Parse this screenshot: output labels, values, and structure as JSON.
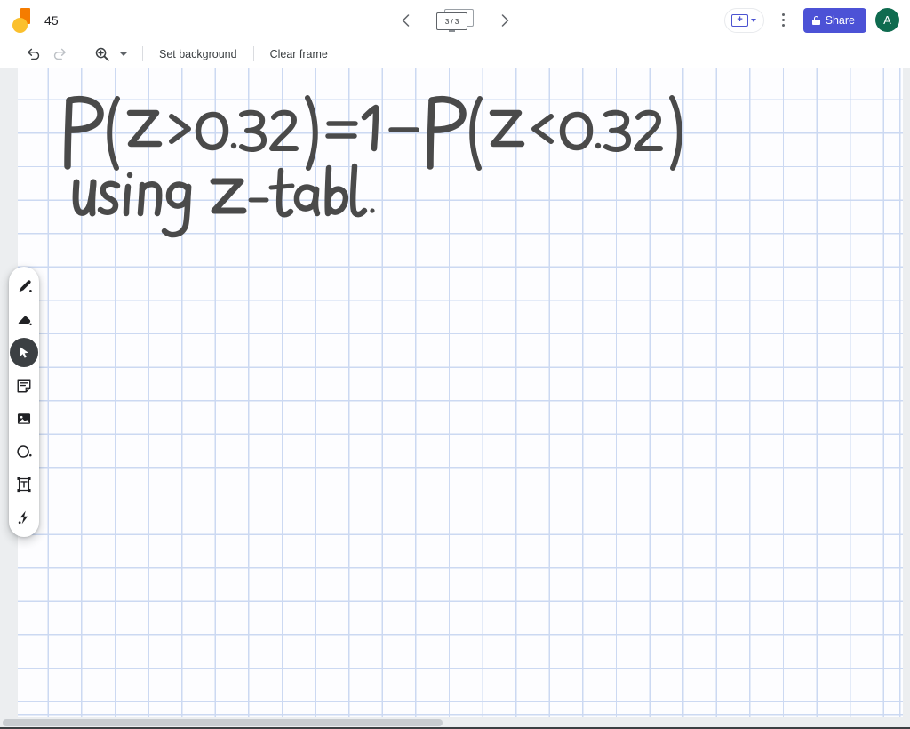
{
  "app": {
    "name": "Jamboard",
    "logo_icon": "jamboard-logo"
  },
  "header": {
    "doc_title": "45",
    "prev_frame_icon": "chevron-left-icon",
    "next_frame_icon": "chevron-right-icon",
    "frame_counter": "3 / 3",
    "frame_counter_icon": "frames-stack-icon",
    "present_icon": "present-add-frame-icon",
    "present_caret_icon": "chevron-down-icon",
    "more_options_icon": "kebab-menu-icon",
    "share_label": "Share",
    "share_lock_icon": "lock-icon",
    "avatar_initial": "A",
    "colors": {
      "share_bg": "#4c52d6",
      "avatar_bg": "#0f6b4f",
      "present_accent": "#4b53d1"
    }
  },
  "toolbar": {
    "undo_icon": "undo-icon",
    "redo_icon": "redo-icon",
    "zoom_icon": "zoom-in-icon",
    "zoom_caret_icon": "chevron-down-icon",
    "set_background_label": "Set background",
    "clear_frame_label": "Clear frame"
  },
  "tools": [
    {
      "name": "pen",
      "icon": "pen-icon",
      "active": false
    },
    {
      "name": "eraser",
      "icon": "eraser-icon",
      "active": false
    },
    {
      "name": "select",
      "icon": "cursor-arrow-icon",
      "active": true
    },
    {
      "name": "sticky-note",
      "icon": "sticky-note-icon",
      "active": false
    },
    {
      "name": "image",
      "icon": "image-icon",
      "active": false
    },
    {
      "name": "shape",
      "icon": "circle-shape-icon",
      "active": false
    },
    {
      "name": "text-box",
      "icon": "text-box-icon",
      "active": false
    },
    {
      "name": "laser",
      "icon": "laser-pointer-icon",
      "active": false
    }
  ],
  "canvas": {
    "background": "graph-grid",
    "grid_color": "#ccd9f2",
    "paper_color": "#fdfdff",
    "ink_color": "#4a4a4a",
    "handwriting": [
      "P(Z>0.32) = 1 - P(Z<0.32)",
      "using Z-tabl"
    ]
  },
  "scrollbars": {
    "horizontal_thumb": "horizontal-scroll-thumb"
  }
}
